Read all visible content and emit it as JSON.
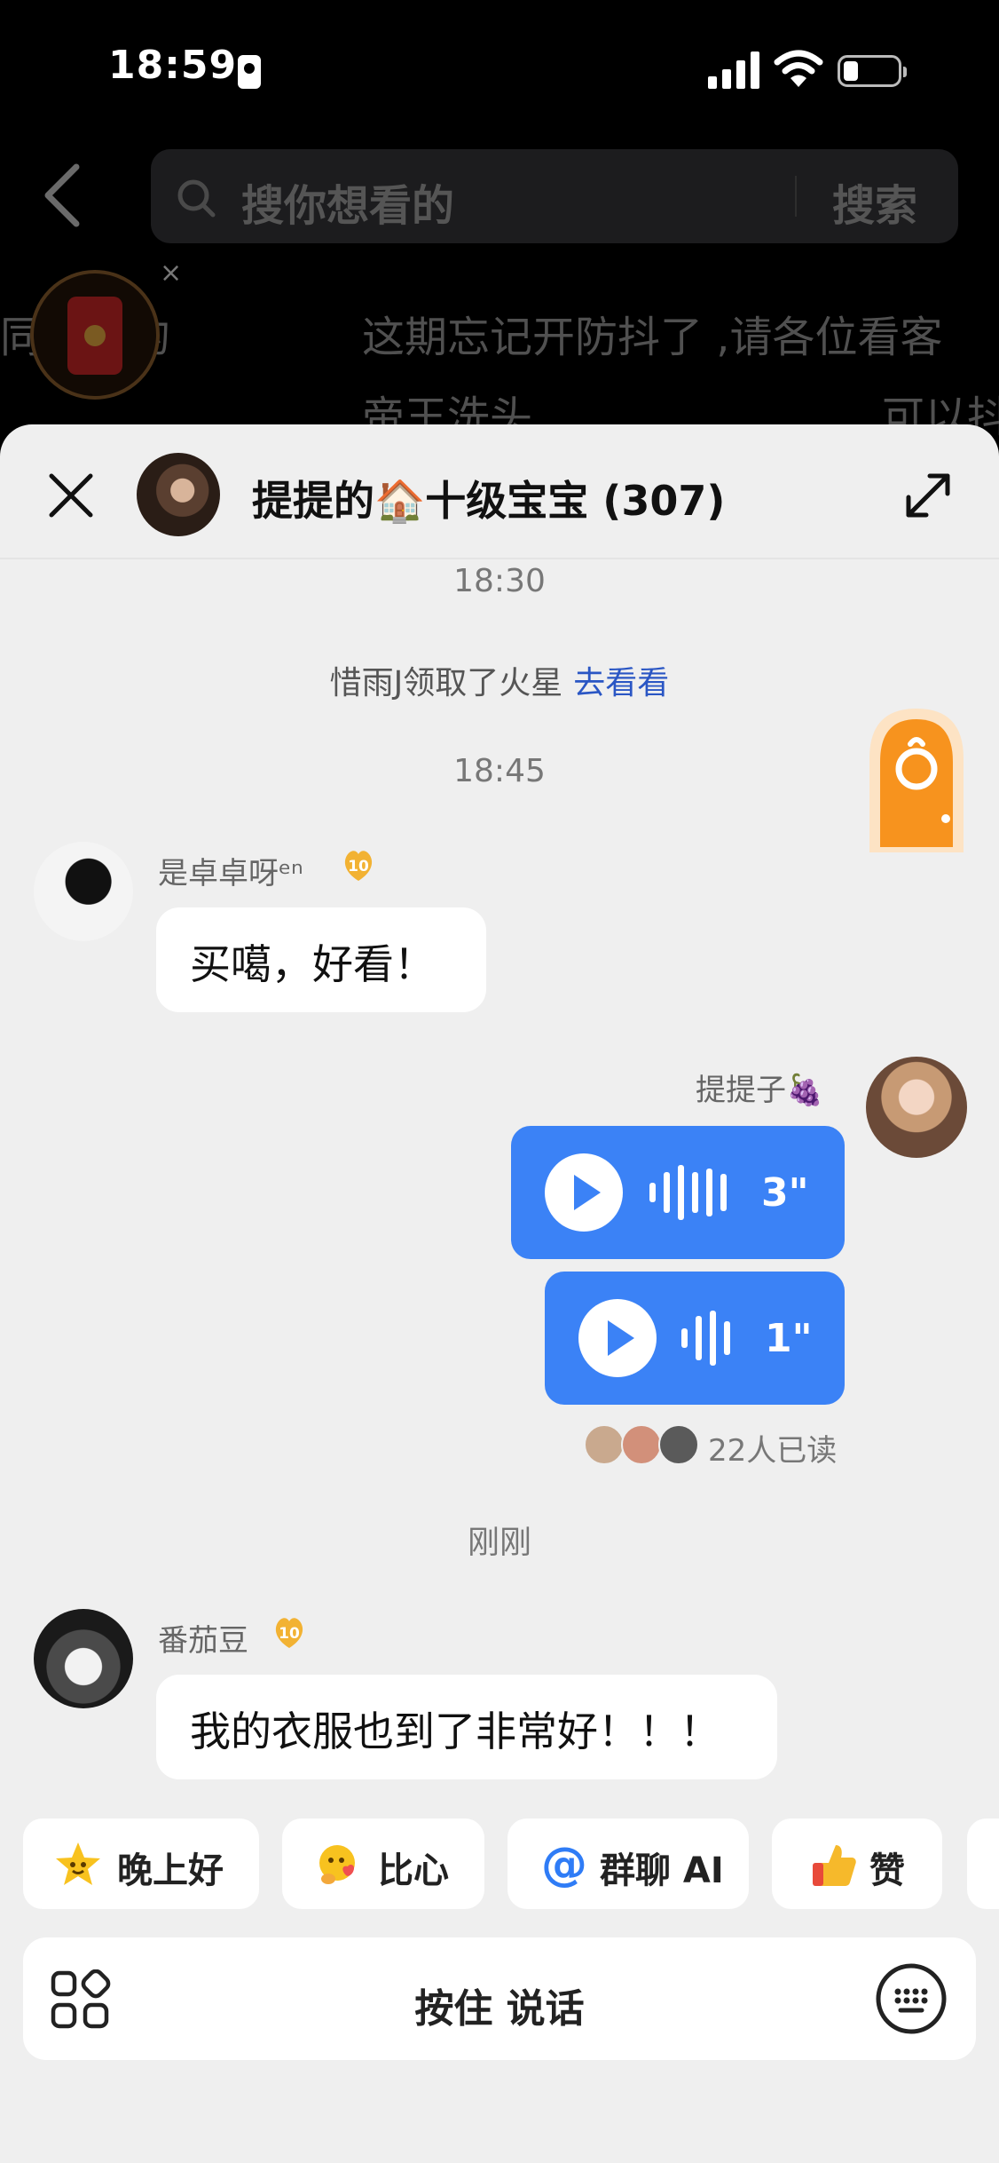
{
  "status_bar": {
    "time": "18:59"
  },
  "search": {
    "placeholder": "搜你想看的",
    "button": "搜索"
  },
  "background_video": {
    "text_left": "同样就的",
    "text_line1": "这期忘记开防抖了 ,请各位看客",
    "text_line2_left": "帝王洗头",
    "text_line2_right": "可以抖",
    "close_mark": "×"
  },
  "chat": {
    "title": "提提的🏠十级宝宝 (307)",
    "timestamps": [
      "18:30",
      "18:45",
      "刚刚"
    ],
    "system_message": {
      "text": "惜雨J领取了火星",
      "link": "去看看"
    },
    "messages": [
      {
        "sender": "是卓卓呀ᵉⁿ",
        "level": "10",
        "text": "买噶，好看！"
      },
      {
        "sender": "提提子🍇",
        "voice": [
          "3\"",
          "1\""
        ],
        "read_receipt": "22人已读"
      },
      {
        "sender": "番茄豆",
        "level": "10",
        "text": "我的衣服也到了非常好！！！"
      }
    ]
  },
  "quick_replies": [
    {
      "label": "晚上好",
      "icon": "star-face-emoji"
    },
    {
      "label": "比心",
      "icon": "heart-hands-emoji"
    },
    {
      "label": "群聊 AI",
      "icon": "at-icon"
    },
    {
      "label": "赞",
      "icon": "thumbs-up-emoji"
    }
  ],
  "input_bar": {
    "label": "按住 说话"
  },
  "colors": {
    "accent_blue": "#3b82f6",
    "link_blue": "#2a56c4",
    "sheet_bg": "#efefef",
    "badge_gold": "#f2b233"
  }
}
